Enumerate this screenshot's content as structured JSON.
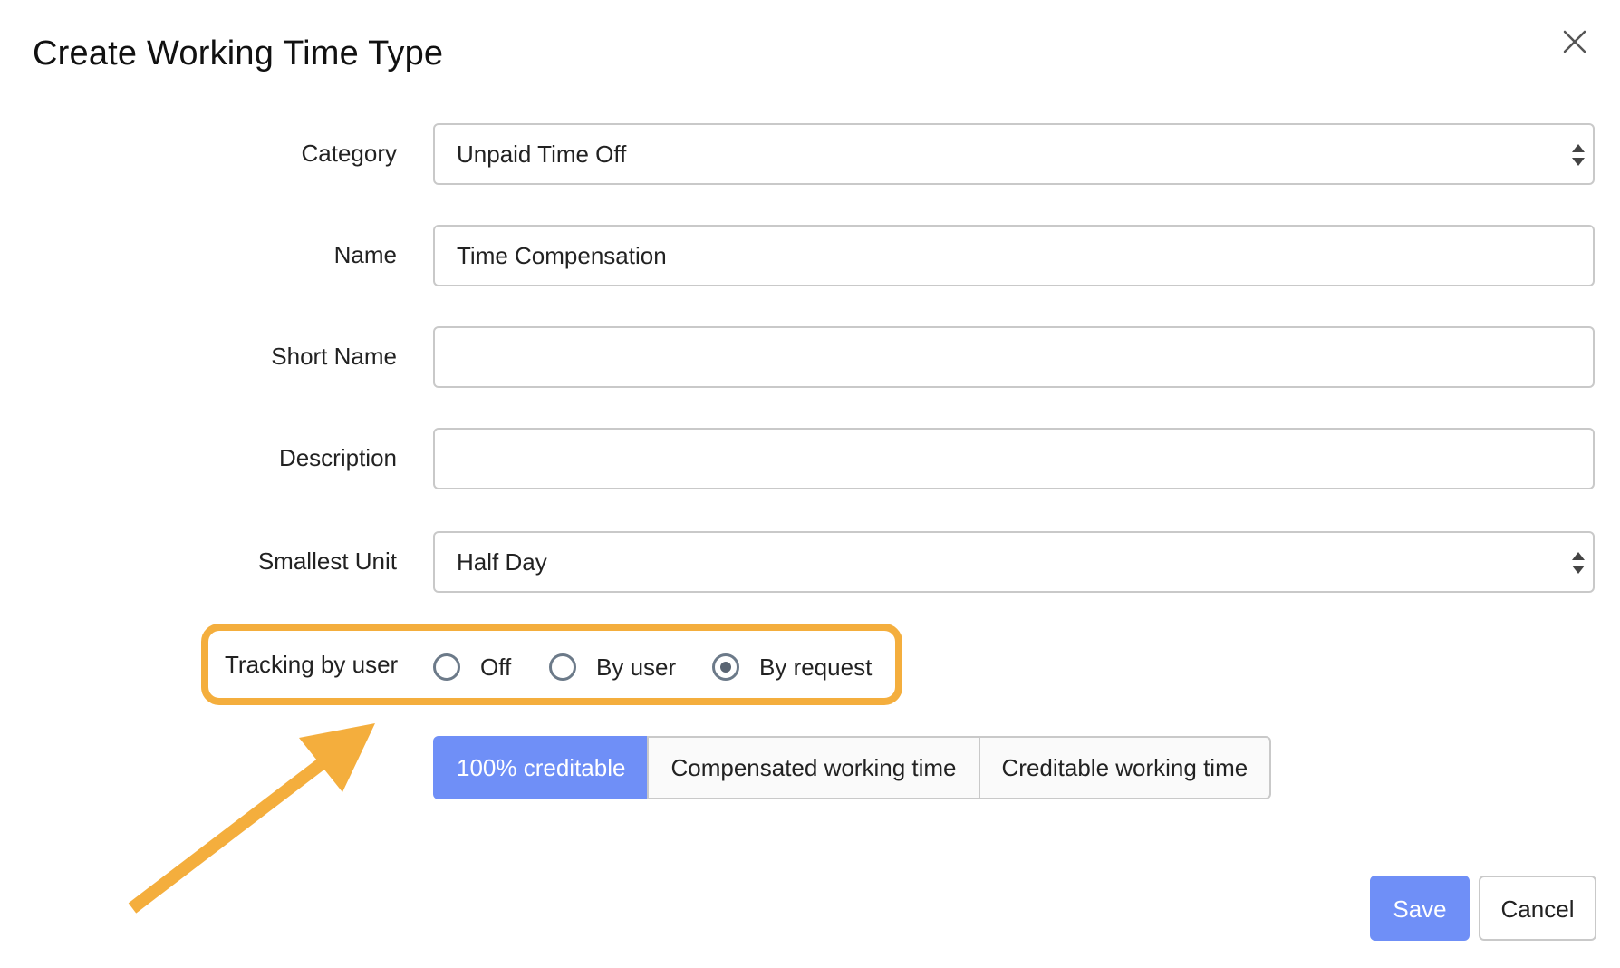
{
  "dialog": {
    "title": "Create Working Time Type"
  },
  "form": {
    "category": {
      "label": "Category",
      "value": "Unpaid Time Off"
    },
    "name": {
      "label": "Name",
      "value": "Time Compensation"
    },
    "short_name": {
      "label": "Short Name",
      "value": ""
    },
    "description": {
      "label": "Description",
      "value": ""
    },
    "smallest_unit": {
      "label": "Smallest Unit",
      "value": "Half Day"
    },
    "tracking": {
      "label": "Tracking by user",
      "options": [
        {
          "label": "Off",
          "checked": false
        },
        {
          "label": "By user",
          "checked": false
        },
        {
          "label": "By request",
          "checked": true
        }
      ]
    },
    "credit_mode": {
      "options": [
        {
          "label": "100% creditable",
          "active": true
        },
        {
          "label": "Compensated working time",
          "active": false
        },
        {
          "label": "Creditable working time",
          "active": false
        }
      ]
    }
  },
  "footer": {
    "save_label": "Save",
    "cancel_label": "Cancel"
  },
  "colors": {
    "accent": "#6f8ff7",
    "highlight": "#f4ae3d",
    "border": "#c9c9c9"
  },
  "icons": {
    "close": "close-icon",
    "select_arrows": "sort-arrows-icon",
    "annotation_arrow": "arrow-up-right-icon"
  }
}
